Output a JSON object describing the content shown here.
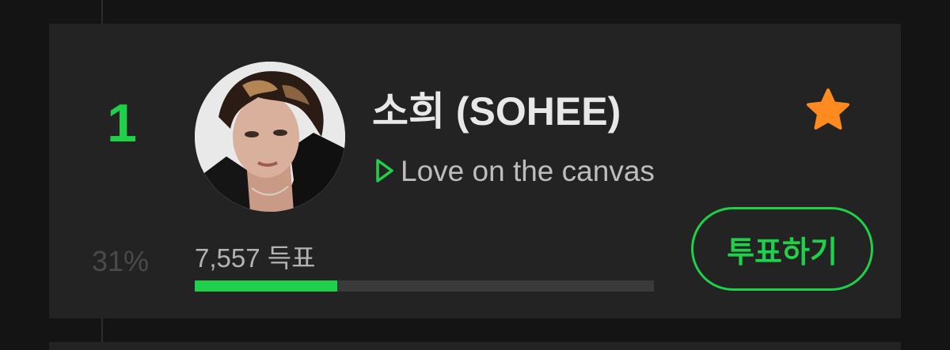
{
  "entry": {
    "rank": "1",
    "name": "소희 (SOHEE)",
    "song": "Love on the canvas",
    "percent": "31%",
    "votes": "7,557 득표",
    "vote_fraction": 0.31,
    "vote_button_label": "투표하기",
    "favorite_icon": "star-icon",
    "play_icon": "play-outline-icon"
  },
  "colors": {
    "accent": "#1fd04a",
    "star": "#ff8a1f",
    "background": "#141414",
    "card": "#232323"
  }
}
